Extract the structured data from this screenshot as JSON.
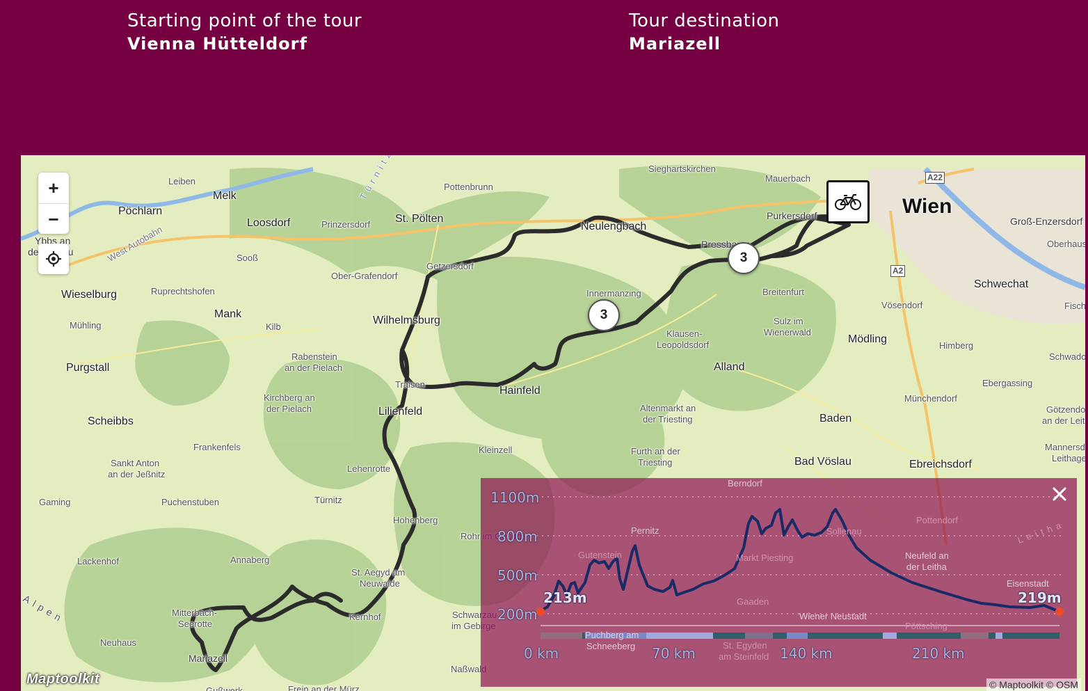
{
  "tour": {
    "start_label": "Starting point of the tour",
    "start_value": "Vienna Hütteldorf",
    "dest_label": "Tour destination",
    "dest_value": "Mariazell"
  },
  "map": {
    "zoom_in": "+",
    "zoom_out": "−",
    "locate_icon": "crosshair-icon",
    "logo": "Maptoolkit",
    "attribution": "© Maptoolkit © OSM",
    "route_marker_icon": "bicycle-icon",
    "clusters": [
      {
        "count": "3"
      },
      {
        "count": "3"
      }
    ],
    "labels": {
      "leiben": "Leiben",
      "melk": "Melk",
      "pochlarn": "Pöchlarn",
      "loosdorf": "Loosdorf",
      "prinzersdorf": "Prinzersdorf",
      "st_polten": "St. Pölten",
      "pottenbrunn": "Pottenbrunn",
      "sieghartskirchen": "Sieghartskirchen",
      "mauerbach": "Mauerbach",
      "purkersdorf": "Purkersdorf",
      "wien": "Wien",
      "gross_enzersdorf": "Groß-Enzersdorf",
      "oberhaus": "Oberhaus",
      "ybbs": "Ybbs an",
      "ybbs2": "der Donau",
      "soos": "Sooß",
      "oberg": "Ober-Grafendorf",
      "getzersdorf": "Getzersdorf",
      "neulengbach": "Neulengbach",
      "pressbaum": "Pressbaum",
      "schwechat": "Schwechat",
      "wieselburg": "Wieselburg",
      "ruprechtshofen": "Ruprechtshofen",
      "mank": "Mank",
      "kilb": "Kilb",
      "wilhelmsburg": "Wilhelmsburg",
      "innermanzing": "Innermanzing",
      "breitenfurt": "Breitenfurt",
      "vosendorf": "Vösendorf",
      "muhling": "Mühling",
      "sulz": "Sulz im",
      "sulz2": "Wienerwald",
      "klausen": "Klausen-",
      "klausen2": "Leopoldsdorf",
      "modling": "Mödling",
      "himberg": "Himberg",
      "purgstall": "Purgstall",
      "rabenstein": "Rabenstein",
      "rabenstein2": "an der Pielach",
      "alland": "Alland",
      "traisen": "Traisen",
      "hainfeld": "Hainfeld",
      "kirchberg": "Kirchberg an",
      "kirchberg2": "der Pielach",
      "lilienfeld": "Lilienfeld",
      "scheibbs": "Scheibbs",
      "altenmarkt": "Altenmarkt an",
      "altenmarkt2": "der Triesting",
      "baden": "Baden",
      "munchendorf": "Münchendorf",
      "ebergassing": "Ebergassing",
      "frankenfels": "Frankenfels",
      "kleinzell": "Kleinzell",
      "furth": "Furth an der",
      "furth2": "Triesting",
      "bad_voslau": "Bad Vöslau",
      "ebreichsdorf": "Ebreichsdorf",
      "sankt_anton": "Sankt Anton",
      "sankt_anton2": "an der Jeßnitz",
      "lehenrotte": "Lehenrotte",
      "gaming": "Gaming",
      "puchenstuben": "Puchenstuben",
      "turnitz": "Türnitz",
      "hohenberg": "Hohenberg",
      "rohr": "Rohr im Gebirge",
      "lackenhof": "Lackenhof",
      "annaberg": "Annaberg",
      "st_aegyd": "St. Aegyd am",
      "st_aegyd2": "Neuwalde",
      "mitterbach": "Mitterbach-",
      "mitterbach2": "Seerotte",
      "kernhof": "Kernhof",
      "schwarzau": "Schwarzau",
      "schwarzau2": "im Gebirge",
      "neuhaus": "Neuhaus",
      "mariazell": "Mariazell",
      "nasswald": "Naßwald",
      "gusswerk": "Gußwerk",
      "frein": "Frein an der Mürz",
      "schwadorf": "Schwadorf",
      "fisch": "Fischamend",
      "gotzendorf": "Götzendorf",
      "gotzendorf2": "an der Leitha",
      "manners": "Mannersdorf",
      "manners2": "Leithagebirge",
      "west_autobahn": "West Autobahn",
      "turnitz_river": "Türnitz",
      "alpen": "Alpen",
      "leitha": "Leitha",
      "a22": "A22",
      "a2": "A2",
      "berndorf": "Berndorf",
      "pernitz": "Pernitz",
      "gutenstein": "Gutenstein",
      "markt_piesting": "Markt Piesting",
      "sollenau": "Sollenau",
      "pottendorf": "Pottendorf",
      "neufeld": "Neufeld an",
      "neufeld2": "der Leitha",
      "eisenstadt": "Eisenstadt",
      "gaaden": "Gaaden",
      "wr_neustadt": "Wiener Neustadt",
      "pottsching": "Pöttsching",
      "puchberg": "Puchberg am",
      "schneeberg": "Schneeberg",
      "st_egyden": "St. Egyden",
      "st_egyden2": "am Steinfeld"
    }
  },
  "elevation": {
    "close_icon": "close-icon",
    "y_labels": [
      "1100m",
      "800m",
      "500m",
      "200m"
    ],
    "x_labels": [
      "0 km",
      "70 km",
      "140 km",
      "210 km"
    ],
    "start_elev": "213m",
    "end_elev": "219m",
    "line_color": "#1a2a66",
    "endpoint_color": "#f04a2a"
  }
}
